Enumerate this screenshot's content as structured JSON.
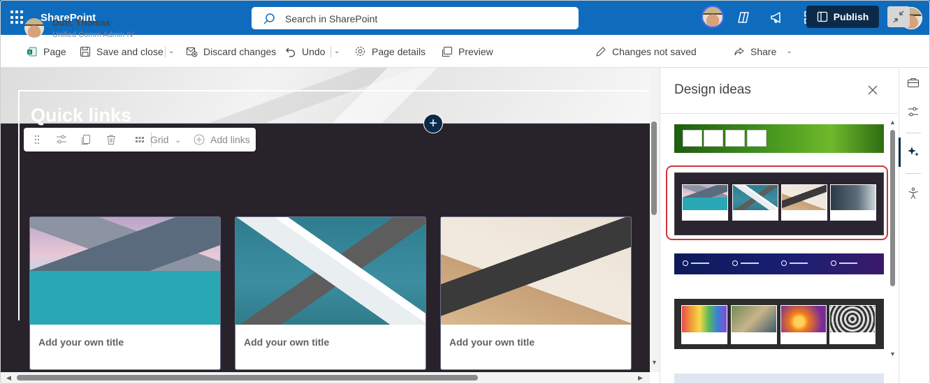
{
  "suitebar": {
    "app_name": "SharePoint",
    "search_placeholder": "Search in SharePoint",
    "help_glyph": "?",
    "icons": [
      "waffle-icon",
      "copilot-icon",
      "megaphone-icon",
      "network-icon",
      "settings-icon",
      "help-icon"
    ]
  },
  "commandbar": {
    "page_label": "Page",
    "save_close_label": "Save and close",
    "discard_label": "Discard changes",
    "undo_label": "Undo",
    "page_details_label": "Page details",
    "preview_label": "Preview",
    "status_label": "Changes not saved",
    "share_label": "Share",
    "publish_label": "Publish"
  },
  "page": {
    "author_name": "Duff, Thomas",
    "author_role": "Unified Comm Admin IV",
    "add_section_glyph": "+",
    "toolbar": {
      "layout_label": "Grid",
      "add_links_label": "Add links"
    },
    "quick_links": {
      "title": "Quick links",
      "cards": [
        {
          "title": "Add your own title",
          "image": "mountain-lake"
        },
        {
          "title": "Add your own title",
          "image": "white-building"
        },
        {
          "title": "Add your own title",
          "image": "laptop-typing"
        }
      ]
    }
  },
  "design_panel": {
    "title": "Design ideas",
    "selected_index": 1,
    "selected_color": "#d13438",
    "option_count_visible": 5
  },
  "colors": {
    "suitebar_bg": "#0f6cbd",
    "publish_bg": "#0b2a4a",
    "section_bg": "#28232b"
  }
}
